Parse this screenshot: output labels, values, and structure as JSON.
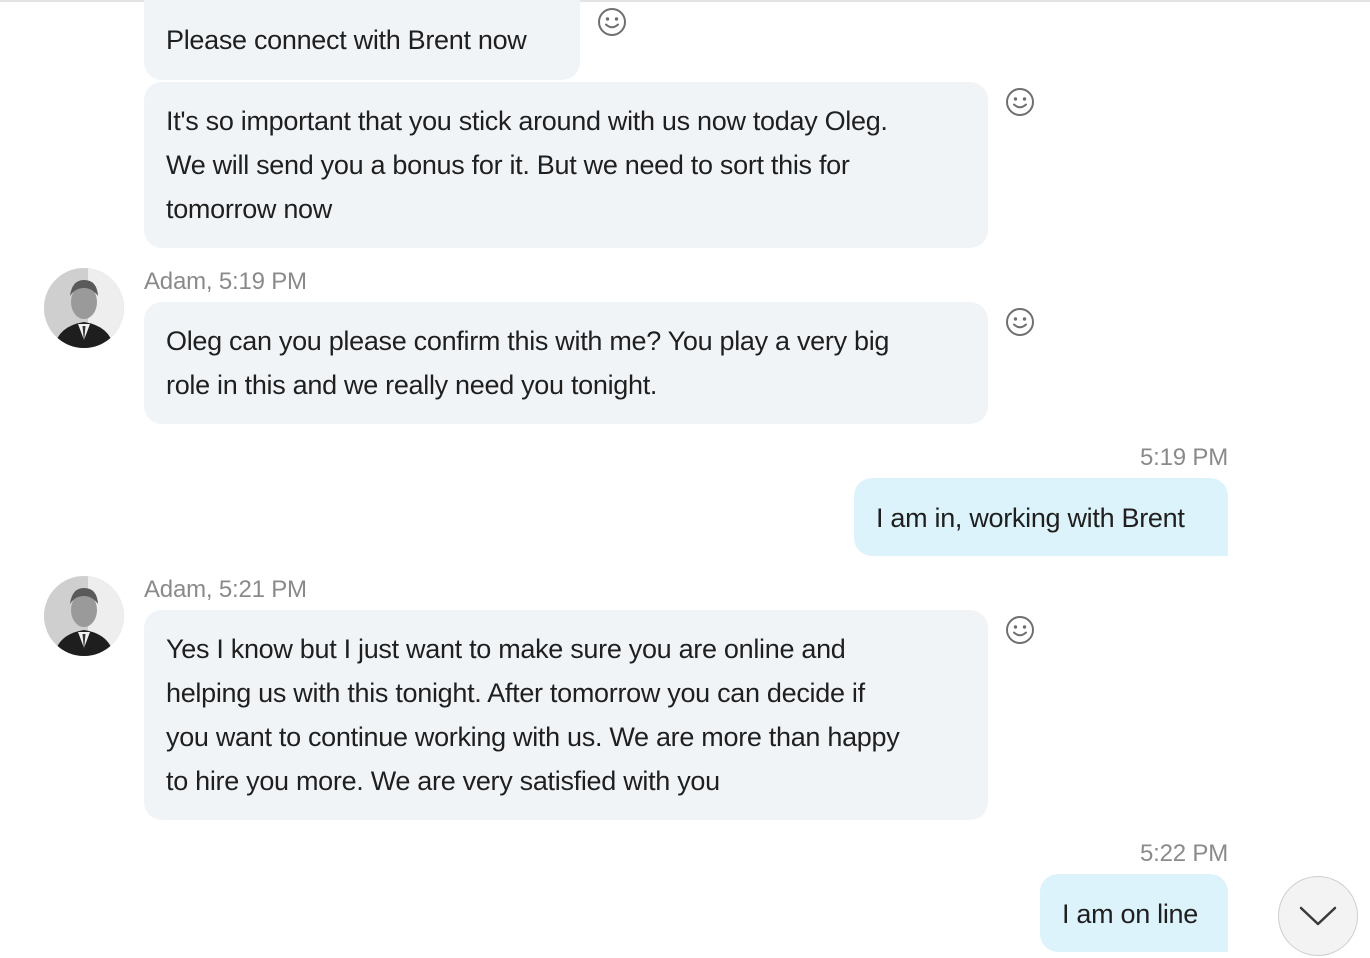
{
  "messages": [
    {
      "sender": "",
      "time": "",
      "lines": [
        "Please connect with Brent now"
      ]
    },
    {
      "sender": "",
      "time": "",
      "lines": [
        "It's so important that you stick around with us now today Oleg.",
        "We will send you a bonus for it. But we need to sort this for",
        "tomorrow now"
      ]
    },
    {
      "header": "Adam, 5:19 PM",
      "lines": [
        "Oleg can you please confirm this with me? You play a very big",
        "role in this and we really need you tonight."
      ]
    },
    {
      "header": "5:19 PM",
      "lines": [
        "I am in, working with Brent"
      ]
    },
    {
      "header": "Adam, 5:21 PM",
      "lines": [
        "Yes I know but I just want to make sure you are online and",
        "helping us with this tonight. After tomorrow you can decide if",
        "you want to continue working with us. We are more than happy",
        "to hire you more. We are very satisfied with you"
      ]
    },
    {
      "header": "5:22 PM",
      "lines": [
        "I am on line"
      ]
    }
  ],
  "icons": {
    "reaction": "smiley-face-icon",
    "scroll": "chevron-down-icon",
    "avatar": "contact-avatar"
  },
  "colors": {
    "incoming_bubble": "#f1f4f7",
    "outgoing_bubble": "#ddf3fb",
    "meta_text": "#8a8a8a"
  }
}
